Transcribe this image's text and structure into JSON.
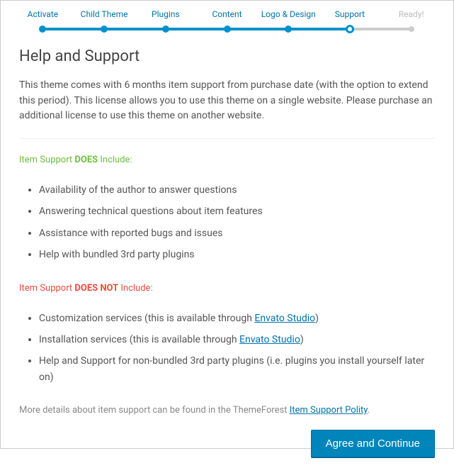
{
  "stepper": {
    "items": [
      {
        "label": "Activate",
        "state": "done"
      },
      {
        "label": "Child Theme",
        "state": "done"
      },
      {
        "label": "Plugins",
        "state": "done"
      },
      {
        "label": "Content",
        "state": "done"
      },
      {
        "label": "Logo & Design",
        "state": "done"
      },
      {
        "label": "Support",
        "state": "current"
      },
      {
        "label": "Ready!",
        "state": "disabled"
      }
    ]
  },
  "page": {
    "title": "Help and Support",
    "intro": "This theme comes with 6 months item support from purchase date (with the option to extend this period). This license allows you to use this theme on a single website. Please purchase an additional license to use this theme on another website."
  },
  "includes": {
    "prefix": "Item Support ",
    "bold": "DOES",
    "suffix": " Include:",
    "items": [
      "Availability of the author to answer questions",
      "Answering technical questions about item features",
      "Assistance with reported bugs and issues",
      "Help with bundled 3rd party plugins"
    ]
  },
  "excludes": {
    "prefix": "Item Support ",
    "bold": "DOES NOT",
    "suffix": " Include:",
    "items": [
      {
        "before": "Customization services (this is available through ",
        "link": "Envato Studio",
        "after": ")"
      },
      {
        "before": "Installation services (this is available through ",
        "link": "Envato Studio",
        "after": ")"
      },
      {
        "before": "Help and Support for non-bundled 3rd party plugins (i.e. plugins you install yourself later on)",
        "link": "",
        "after": ""
      }
    ]
  },
  "footer": {
    "before": "More details about item support can be found in the ThemeForest ",
    "link": "Item Support Polity",
    "after": "."
  },
  "buttons": {
    "continue": "Agree and Continue"
  }
}
